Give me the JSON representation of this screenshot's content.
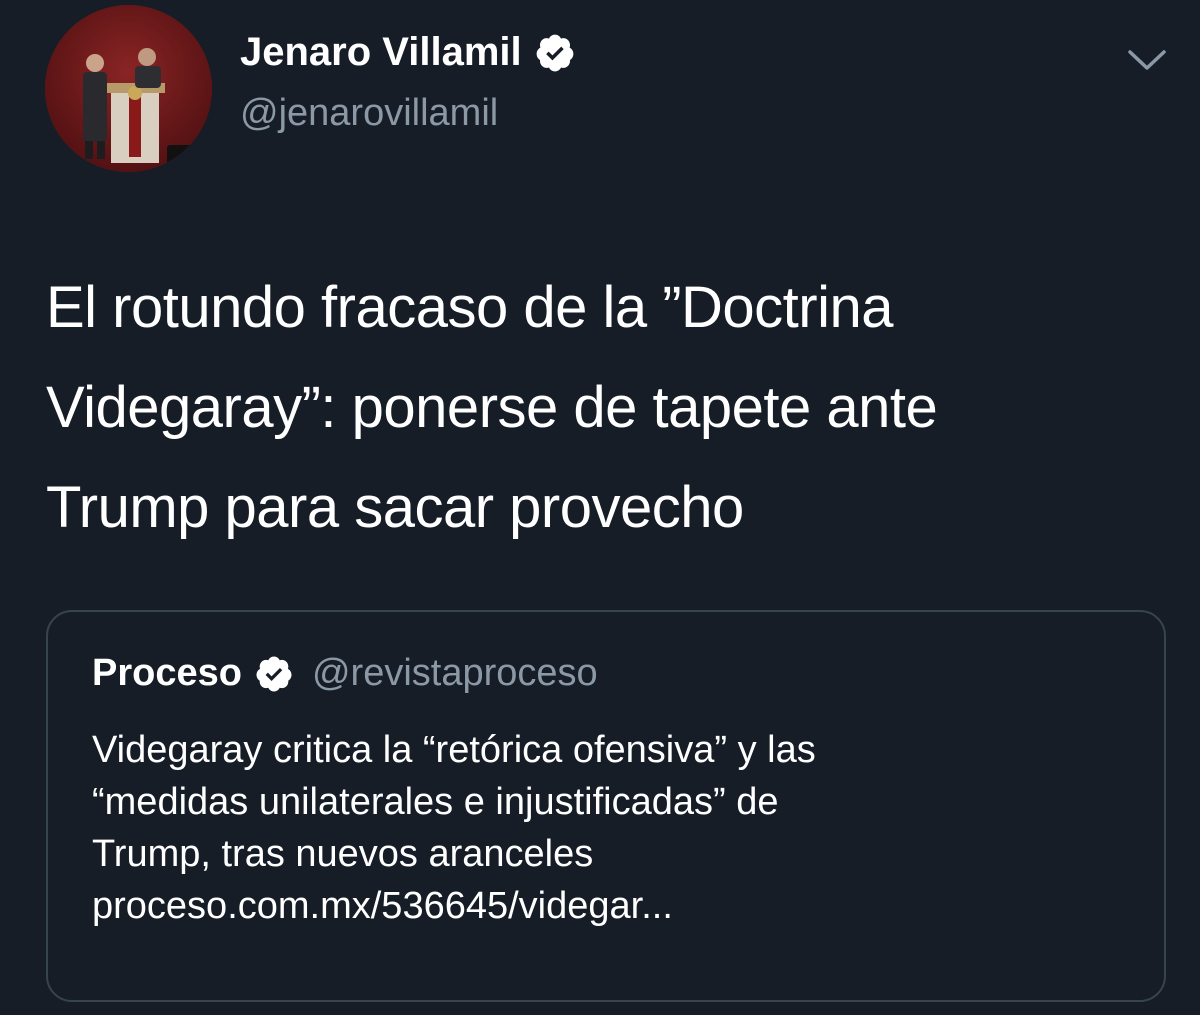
{
  "author": {
    "name": "Jenaro Villamil",
    "handle": "@jenarovillamil",
    "verified": true
  },
  "tweet": {
    "lines": [
      "El rotundo fracaso de la ”Doctrina",
      "Videgaray”: ponerse de tapete ante",
      "Trump para sacar provecho"
    ]
  },
  "quoted_tweet": {
    "name": "Proceso",
    "handle": "@revistaproceso",
    "verified": true,
    "lines": [
      "Videgaray critica la “retórica ofensiva” y las",
      "“medidas unilaterales e injustificadas” de",
      "Trump, tras nuevos aranceles",
      "proceso.com.mx/536645/videgar..."
    ]
  },
  "colors": {
    "background": "#161d27",
    "text_primary": "#ffffff",
    "text_secondary": "#8b98a5",
    "card_border": "#38444d"
  },
  "icons": {
    "verified": "verified-badge-icon",
    "menu": "chevron-down-icon"
  }
}
